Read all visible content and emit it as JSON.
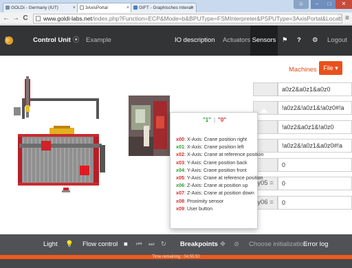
{
  "browser": {
    "tabs": [
      {
        "label": "GOLDi - Germany (IUT)"
      },
      {
        "label": "3AxisPortal"
      },
      {
        "label": "GIFT - Graphisches Interak"
      }
    ],
    "url_domain": "www.goldi-labs.net",
    "url_rest": "/index.php?Function=ECP&Mode=b&BPUType=FSMInterpreter&PSPUType=3AxisPortal&Location=IUT#"
  },
  "navbar": {
    "control_unit": "Control Unit",
    "example": "Example",
    "io_description": "IO description",
    "actuators": "Actuators",
    "sensors": "Sensors",
    "logout": "Logout"
  },
  "panel": {
    "machines": "Machines",
    "file": "File",
    "rows": [
      {
        "label": "",
        "value": "a0z2&a0z1&a0z0"
      },
      {
        "label": "",
        "value": "!a0z2&!a0z1&!a0z0#!a"
      },
      {
        "label": "",
        "value": "!a0z2&a0z1&!a0z0"
      },
      {
        "label": "",
        "value": "!a0z2&!a0z1&a0z0#!a"
      },
      {
        "label": "",
        "value": "0"
      },
      {
        "label": "y05 =",
        "value": "0"
      },
      {
        "label": "y06 =",
        "value": "0"
      }
    ]
  },
  "popup": {
    "one": "\"1\"",
    "separator": "|",
    "zero": "\"0\"",
    "sensors": [
      {
        "code": "x00",
        "text": ": X-Axis: Crane position right",
        "on": false
      },
      {
        "code": "x01",
        "text": ": X-Axis: Crane position left",
        "on": true
      },
      {
        "code": "x02",
        "text": ": X-Axis: Crane at reference position",
        "on": false
      },
      {
        "code": "x03",
        "text": ": Y-Axis: Crane position back",
        "on": false
      },
      {
        "code": "x04",
        "text": ": Y-Axis: Crane position front",
        "on": true
      },
      {
        "code": "x05",
        "text": ": Y-Axis: Crane at reference position",
        "on": false
      },
      {
        "code": "x06",
        "text": ": Z-Axis: Crane at position up",
        "on": true
      },
      {
        "code": "x07",
        "text": ": Z-Axis: Crane at position down",
        "on": false
      },
      {
        "code": "x08",
        "text": ": Proximity sensor",
        "on": false
      },
      {
        "code": "x09",
        "text": ": User button",
        "on": false
      }
    ]
  },
  "toolbar": {
    "light": "Light",
    "flow_control": "Flow control",
    "breakpoints": "Breakpoints",
    "choose_init": "Choose initialization",
    "error_log": "Error log"
  },
  "status": {
    "time_remaining": "Time remaining : 04:55:50"
  },
  "colors": {
    "accent": "#e8521c",
    "navbar": "#333436",
    "toolbar": "#505255",
    "sensor_on": "#2a9d2a",
    "sensor_off": "#d62a2a"
  }
}
